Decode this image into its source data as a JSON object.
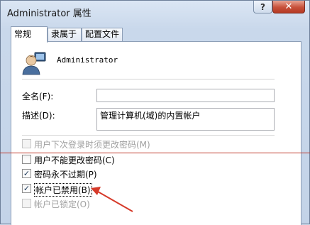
{
  "window": {
    "title": "Administrator 属性"
  },
  "titlebar": {
    "help_label": "?",
    "close_label": "✕"
  },
  "tabs": [
    {
      "label": "常规"
    },
    {
      "label": "隶属于"
    },
    {
      "label": "配置文件"
    }
  ],
  "user": {
    "name": "Administrator"
  },
  "form": {
    "fullname_label": "全名(F):",
    "fullname_value": "",
    "description_label": "描述(D):",
    "description_value": "管理计算机(域)的内置帐户"
  },
  "options": [
    {
      "label": "用户下次登录时须更改密码(M)",
      "checked": false,
      "disabled": true
    },
    {
      "label": "用户不能更改密码(C)",
      "checked": false,
      "disabled": false
    },
    {
      "label": "密码永不过期(P)",
      "checked": true,
      "disabled": false
    },
    {
      "label": "帐户已禁用(B)",
      "checked": true,
      "disabled": false
    },
    {
      "label": "帐户已锁定(O)",
      "checked": false,
      "disabled": true
    }
  ],
  "colors": {
    "annotation": "#d63a2a"
  }
}
